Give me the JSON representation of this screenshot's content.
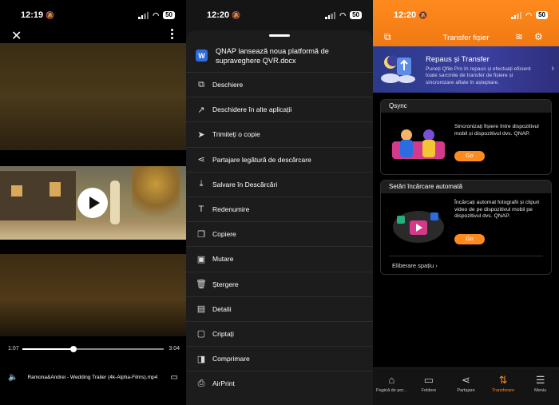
{
  "screens": [
    {
      "status": {
        "time": "12:19",
        "battery": "50"
      },
      "close_icon": "close-icon",
      "video": {
        "current_time": "1:07",
        "duration": "3:04",
        "progress": 0.36
      },
      "file_name": "Ramona&Andrei - Wedding Trailer (4k-Alpha-Films).mp4"
    },
    {
      "status": {
        "time": "12:20",
        "battery": "50"
      },
      "file_icon": "W",
      "file_title": "QNAP lansează noua platformă de supraveghere QVR.docx",
      "menu": [
        {
          "label": "Deschiere",
          "icon": "open-icon"
        },
        {
          "label": "Deschidere în alte aplicații",
          "icon": "open-in-apps-icon"
        },
        {
          "label": "Trimiteți o copie",
          "icon": "send-icon"
        },
        {
          "label": "Partajare legătură de descărcare",
          "icon": "share-icon"
        },
        {
          "label": "Salvare în Descărcări",
          "icon": "download-icon"
        },
        {
          "label": "Redenumire",
          "icon": "rename-icon"
        },
        {
          "label": "Copiere",
          "icon": "copy-icon"
        },
        {
          "label": "Mutare",
          "icon": "move-icon"
        },
        {
          "label": "Ștergere",
          "icon": "trash-icon"
        },
        {
          "label": "Detalii",
          "icon": "details-icon"
        },
        {
          "label": "Criptați",
          "icon": "lock-icon"
        },
        {
          "label": "Comprimare",
          "icon": "compress-icon"
        },
        {
          "label": "AirPrint",
          "icon": "printer-icon"
        }
      ]
    },
    {
      "status": {
        "time": "12:20",
        "battery": "50"
      },
      "header_title": "Transfer fișier",
      "banner": {
        "title": "Repaus și Transfer",
        "description": "Puneți Qfile Pro în repaus și efectuați eficient toate sarcinile de transfer de fișiere și sincronizare aflate în așteptare."
      },
      "qsync": {
        "title": "Qsync",
        "text": "Sincronizați fișiere între dispozitivul mobil și dispozitivul dvs. QNAP.",
        "button": "Go"
      },
      "auto_upload": {
        "title": "Setări încărcare automată",
        "text": "Încărcați automat fotografii și clipuri video de pe dispozitivul mobil pe dispozitivul dvs. QNAP.",
        "button": "Go",
        "free_space": "Eliberare spațiu"
      },
      "tabs": [
        {
          "label": "Pagină de por...",
          "icon": "home-icon"
        },
        {
          "label": "Foldere",
          "icon": "folder-icon"
        },
        {
          "label": "Partajare",
          "icon": "share-icon"
        },
        {
          "label": "Transferare",
          "icon": "transfer-icon"
        },
        {
          "label": "Meniu",
          "icon": "menu-icon"
        }
      ],
      "accent": "#ff8a1e"
    }
  ]
}
